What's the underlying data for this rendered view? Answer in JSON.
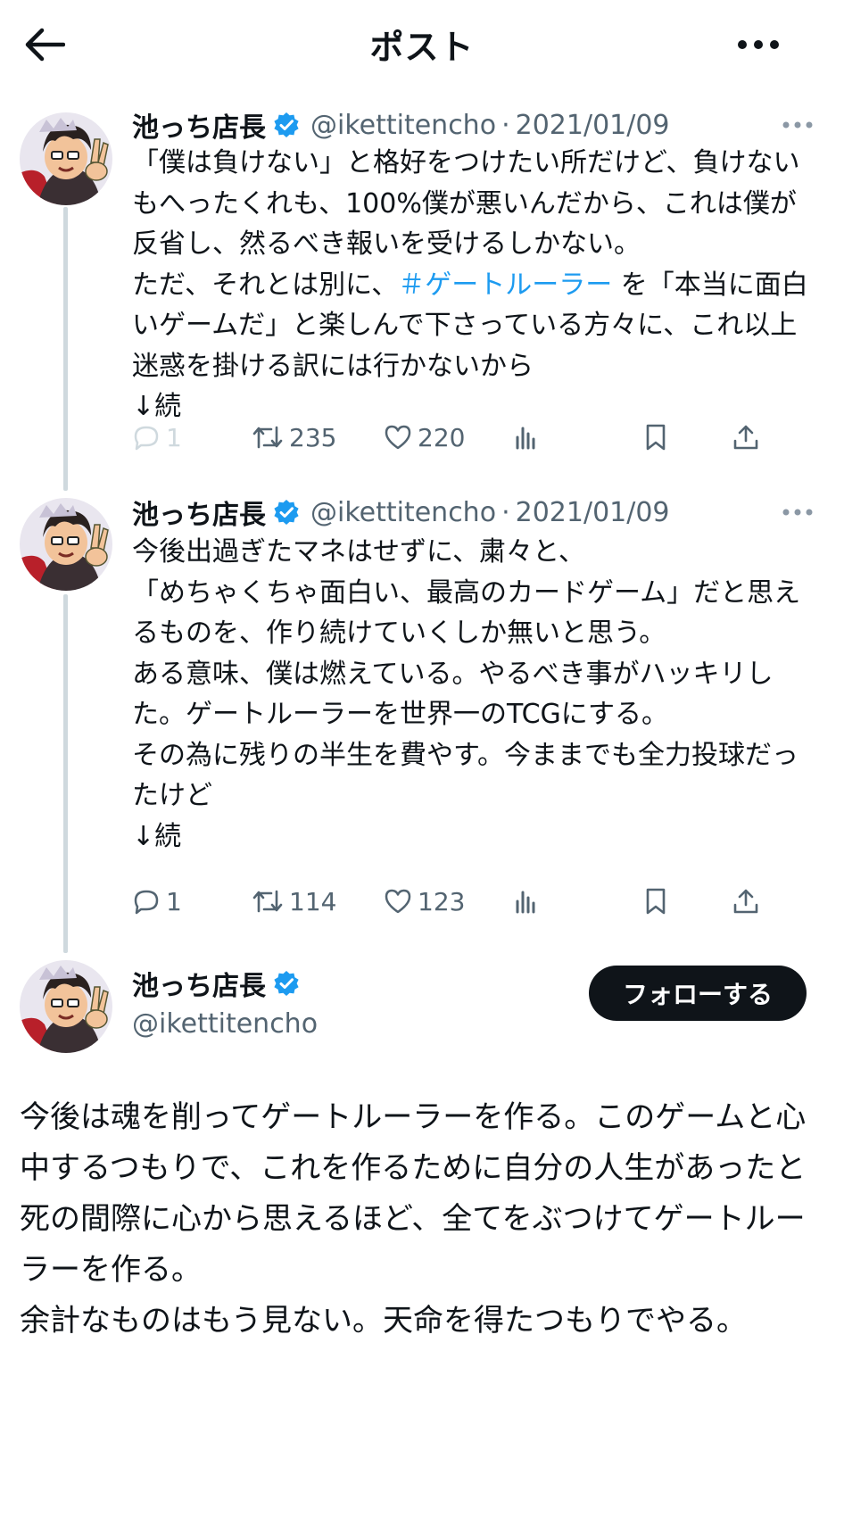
{
  "header": {
    "title": "ポスト",
    "back_icon": "arrow-left-icon",
    "more_icon": "more-horizontal-icon"
  },
  "colors": {
    "accent": "#1d9bf0",
    "text": "#0f1419",
    "secondary": "#536471",
    "thread_line": "#cfd9de",
    "follow_button_bg": "#0f1419"
  },
  "thread": [
    {
      "author_name": "池っち店長",
      "verified": true,
      "handle": "@ikettitencho",
      "separator": "·",
      "date": "2021/01/09",
      "text_before_hashtag": "「僕は負けない」と格好をつけたい所だけど、負けないもへったくれも、100%僕が悪いんだから、これは僕が反省し、然るべき報いを受けるしかない。\nただ、それとは別に、",
      "hashtag": "＃ゲートルーラー",
      "text_after_hashtag": " を「本当に面白いゲームだ」と楽しんで下さっている方々に、これ以上迷惑を掛ける訳には行かないから\n↓続",
      "replies": "1",
      "reposts": "235",
      "likes": "220"
    },
    {
      "author_name": "池っち店長",
      "verified": true,
      "handle": "@ikettitencho",
      "separator": "·",
      "date": "2021/01/09",
      "text": "今後出過ぎたマネはせずに、粛々と、\n「めちゃくちゃ面白い、最高のカードゲーム」だと思えるものを、作り続けていくしか無いと思う。\nある意味、僕は燃えている。やるべき事がハッキリした。ゲートルーラーを世界一のTCGにする。\nその為に残りの半生を費やす。今ままでも全力投球だったけど\n↓続",
      "replies": "1",
      "reposts": "114",
      "likes": "123"
    }
  ],
  "main_post": {
    "author_name": "池っち店長",
    "verified": true,
    "handle": "@ikettitencho",
    "follow_label": "フォローする",
    "text": "今後は魂を削ってゲートルーラーを作る。このゲームと心中するつもりで、これを作るために自分の人生があったと死の間際に心から思えるほど、全てをぶつけてゲートルーラーを作る。\n余計なものはもう見ない。天命を得たつもりでやる。"
  }
}
